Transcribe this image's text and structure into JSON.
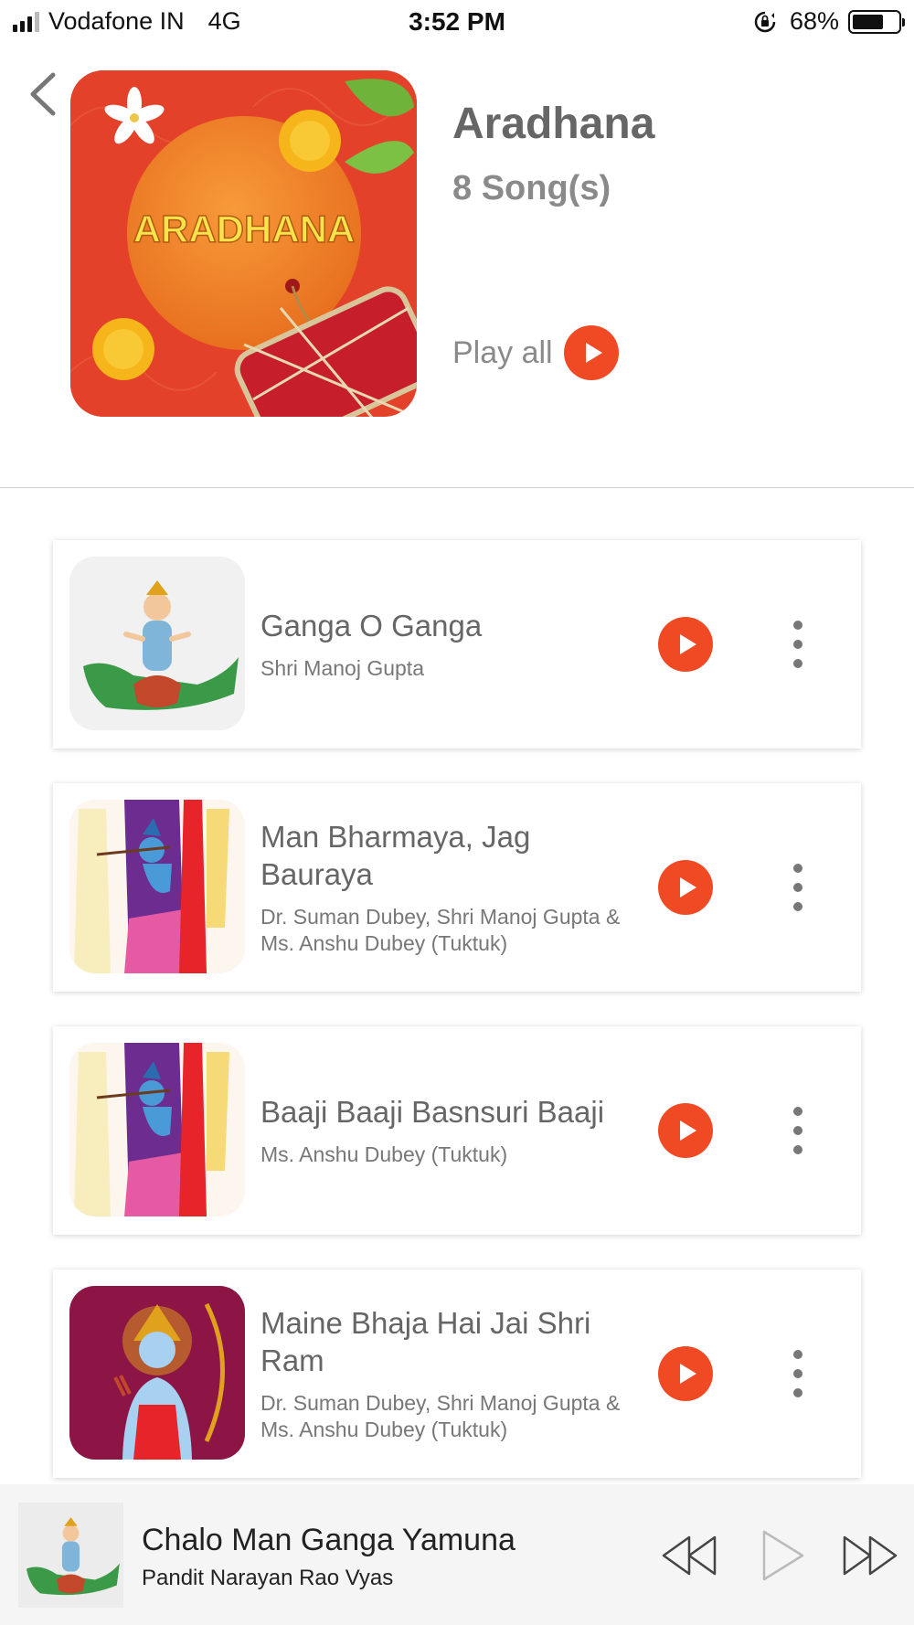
{
  "status_bar": {
    "carrier": "Vodafone IN",
    "network": "4G",
    "time": "3:52 PM",
    "battery": "68%",
    "battery_level": 0.68
  },
  "header": {
    "album_title": "Aradhana",
    "song_count": "8 Song(s)",
    "play_all_label": "Play all",
    "art_text": "ARADHANA"
  },
  "songs": [
    {
      "title": "Ganga O Ganga",
      "artist": "Shri Manoj Gupta"
    },
    {
      "title": "Man Bharmaya, Jag Bauraya",
      "artist": "Dr. Suman Dubey, Shri Manoj Gupta & Ms. Anshu Dubey (Tuktuk)"
    },
    {
      "title": "Baaji Baaji Basnsuri Baaji",
      "artist": "Ms. Anshu Dubey (Tuktuk)"
    },
    {
      "title": "Maine Bhaja Hai Jai Shri Ram",
      "artist": "Dr. Suman Dubey, Shri Manoj Gupta & Ms. Anshu Dubey (Tuktuk)"
    }
  ],
  "now_playing": {
    "title": "Chalo Man Ganga Yamuna",
    "artist": "Pandit Narayan Rao Vyas"
  },
  "colors": {
    "accent": "#f04a24",
    "album_bg": "#e3412a",
    "mini_player_bg": "#f5f5f5"
  }
}
